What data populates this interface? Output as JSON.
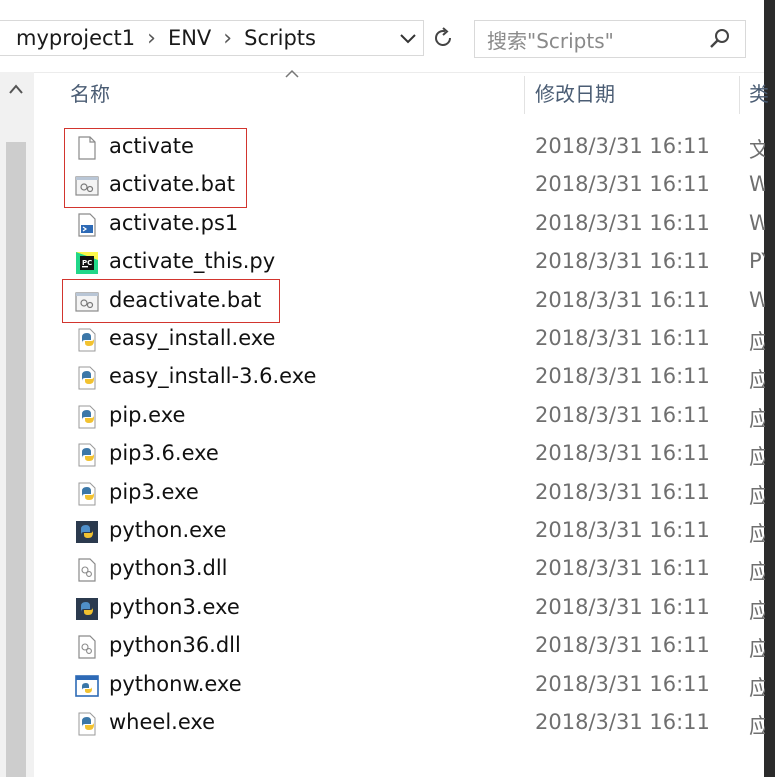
{
  "address": {
    "breadcrumbs": [
      "myproject1",
      "ENV",
      "Scripts"
    ],
    "separator": "›"
  },
  "search": {
    "placeholder": "搜索\"Scripts\""
  },
  "columns": {
    "name": "名称",
    "date": "修改日期",
    "type": "类"
  },
  "files": [
    {
      "name": "activate",
      "date": "2018/3/31 16:11",
      "type": "文",
      "icon": "blank-file-icon"
    },
    {
      "name": "activate.bat",
      "date": "2018/3/31 16:11",
      "type": "W",
      "icon": "batch-file-icon"
    },
    {
      "name": "activate.ps1",
      "date": "2018/3/31 16:11",
      "type": "W",
      "icon": "powershell-file-icon"
    },
    {
      "name": "activate_this.py",
      "date": "2018/3/31 16:11",
      "type": "PY",
      "icon": "pycharm-file-icon"
    },
    {
      "name": "deactivate.bat",
      "date": "2018/3/31 16:11",
      "type": "W",
      "icon": "batch-file-icon"
    },
    {
      "name": "easy_install.exe",
      "date": "2018/3/31 16:11",
      "type": "应",
      "icon": "python-exe-icon"
    },
    {
      "name": "easy_install-3.6.exe",
      "date": "2018/3/31 16:11",
      "type": "应",
      "icon": "python-exe-icon"
    },
    {
      "name": "pip.exe",
      "date": "2018/3/31 16:11",
      "type": "应",
      "icon": "python-exe-icon"
    },
    {
      "name": "pip3.6.exe",
      "date": "2018/3/31 16:11",
      "type": "应",
      "icon": "python-exe-icon"
    },
    {
      "name": "pip3.exe",
      "date": "2018/3/31 16:11",
      "type": "应",
      "icon": "python-exe-icon"
    },
    {
      "name": "python.exe",
      "date": "2018/3/31 16:11",
      "type": "应",
      "icon": "python-app-icon"
    },
    {
      "name": "python3.dll",
      "date": "2018/3/31 16:11",
      "type": "应",
      "icon": "dll-file-icon"
    },
    {
      "name": "python3.exe",
      "date": "2018/3/31 16:11",
      "type": "应",
      "icon": "python-app-icon"
    },
    {
      "name": "python36.dll",
      "date": "2018/3/31 16:11",
      "type": "应",
      "icon": "dll-file-icon"
    },
    {
      "name": "pythonw.exe",
      "date": "2018/3/31 16:11",
      "type": "应",
      "icon": "pythonw-app-icon"
    },
    {
      "name": "wheel.exe",
      "date": "2018/3/31 16:11",
      "type": "应",
      "icon": "python-exe-icon"
    }
  ],
  "colors": {
    "highlight": "#d2352e",
    "header_text": "#4b5d74",
    "date_text": "#6f6f6f"
  }
}
